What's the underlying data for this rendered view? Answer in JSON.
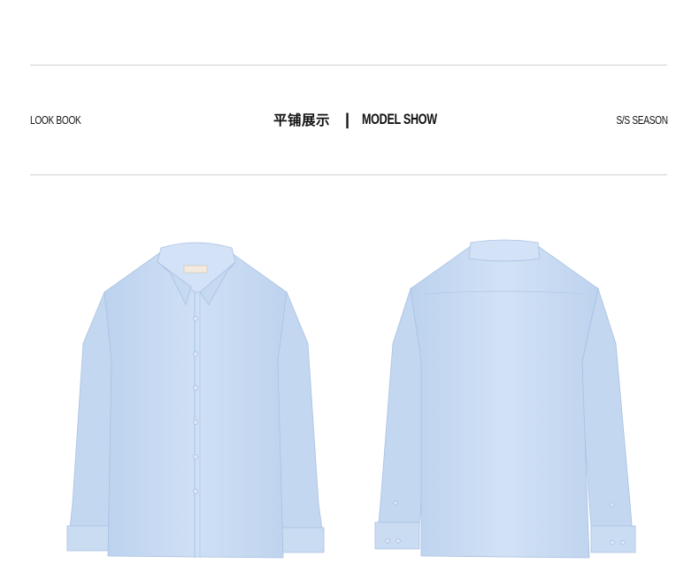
{
  "header": {
    "left_label": "LOOK BOOK",
    "title_cn": "平铺展示",
    "separator": "|",
    "title_en": "MODEL SHOW",
    "right_label": "S/S SEASON"
  },
  "images": {
    "front": "shirt-front",
    "back": "shirt-back"
  },
  "colors": {
    "shirt_fill": "#c9dcf3",
    "shirt_shade": "#b4cbe9",
    "rule": "#cfcfcf"
  }
}
